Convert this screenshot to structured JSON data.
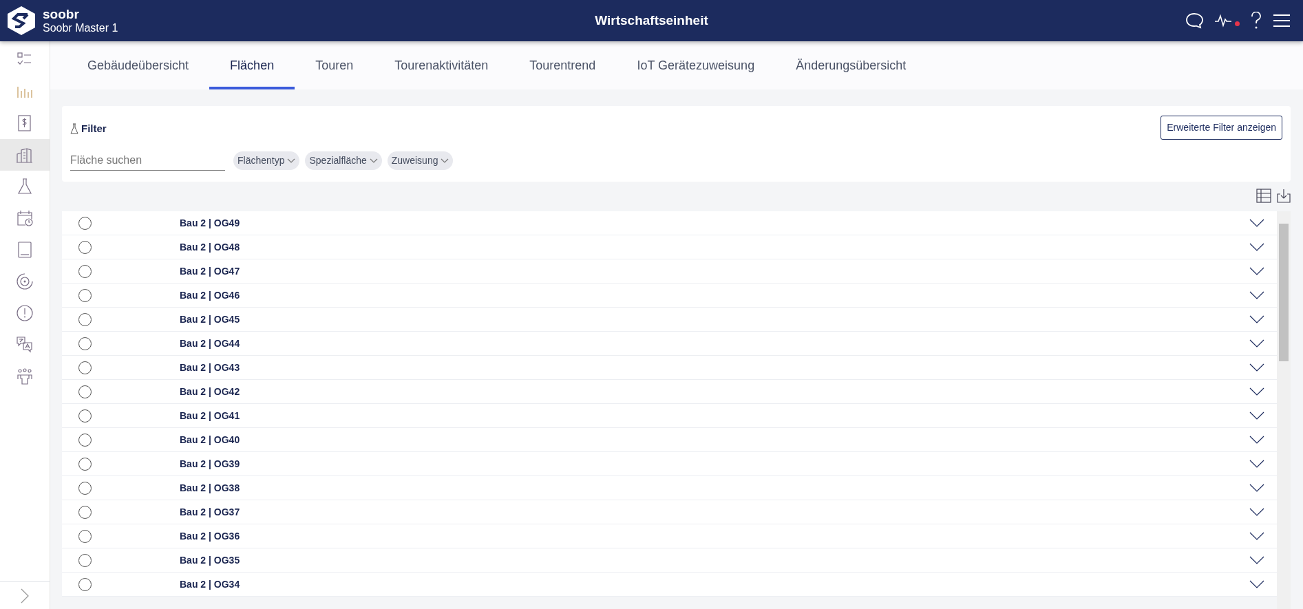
{
  "header": {
    "brand": "soobr",
    "subtitle": "Soobr Master 1",
    "title": "Wirtschaftseinheit",
    "alert_dot": true
  },
  "sidebar": {
    "items": [
      {
        "kind": "checklist",
        "selected": false
      },
      {
        "kind": "chart",
        "selected": false
      },
      {
        "kind": "dollar",
        "selected": false
      },
      {
        "kind": "buildings",
        "selected": true
      },
      {
        "kind": "flask",
        "selected": false
      },
      {
        "kind": "calendar",
        "selected": false
      },
      {
        "kind": "tablet",
        "selected": false
      },
      {
        "kind": "target",
        "selected": false
      },
      {
        "kind": "alert",
        "selected": false
      },
      {
        "kind": "translate",
        "selected": false
      },
      {
        "kind": "people",
        "selected": false
      }
    ]
  },
  "tabs": [
    {
      "label": "Gebäudeübersicht",
      "selected": false
    },
    {
      "label": "Flächen",
      "selected": true
    },
    {
      "label": "Touren",
      "selected": false
    },
    {
      "label": "Tourenaktivitäten",
      "selected": false
    },
    {
      "label": "Tourentrend",
      "selected": false
    },
    {
      "label": "IoT Gerätezuweisung",
      "selected": false
    },
    {
      "label": "Änderungsübersicht",
      "selected": false
    }
  ],
  "filter": {
    "title": "Filter",
    "advanced_button": "Erweiterte Filter anzeigen",
    "search": {
      "placeholder": "Fläche suchen"
    },
    "chips": [
      "Flächentyp",
      "Spezialfläche",
      "Zuweisung"
    ]
  },
  "rows": [
    {
      "label": "Bau 2 | OG49",
      "selected": false
    },
    {
      "label": "Bau 2 | OG48",
      "selected": false
    },
    {
      "label": "Bau 2 | OG47",
      "selected": false
    },
    {
      "label": "Bau 2 | OG46",
      "selected": false
    },
    {
      "label": "Bau 2 | OG45",
      "selected": false
    },
    {
      "label": "Bau 2 | OG44",
      "selected": false
    },
    {
      "label": "Bau 2 | OG43",
      "selected": false
    },
    {
      "label": "Bau 2 | OG42",
      "selected": false
    },
    {
      "label": "Bau 2 | OG41",
      "selected": false
    },
    {
      "label": "Bau 2 | OG40",
      "selected": false
    },
    {
      "label": "Bau 2 | OG39",
      "selected": false
    },
    {
      "label": "Bau 2 | OG38",
      "selected": false
    },
    {
      "label": "Bau 2 | OG37",
      "selected": false
    },
    {
      "label": "Bau 2 | OG36",
      "selected": false
    },
    {
      "label": "Bau 2 | OG35",
      "selected": false
    },
    {
      "label": "Bau 2 | OG34",
      "selected": false
    }
  ]
}
